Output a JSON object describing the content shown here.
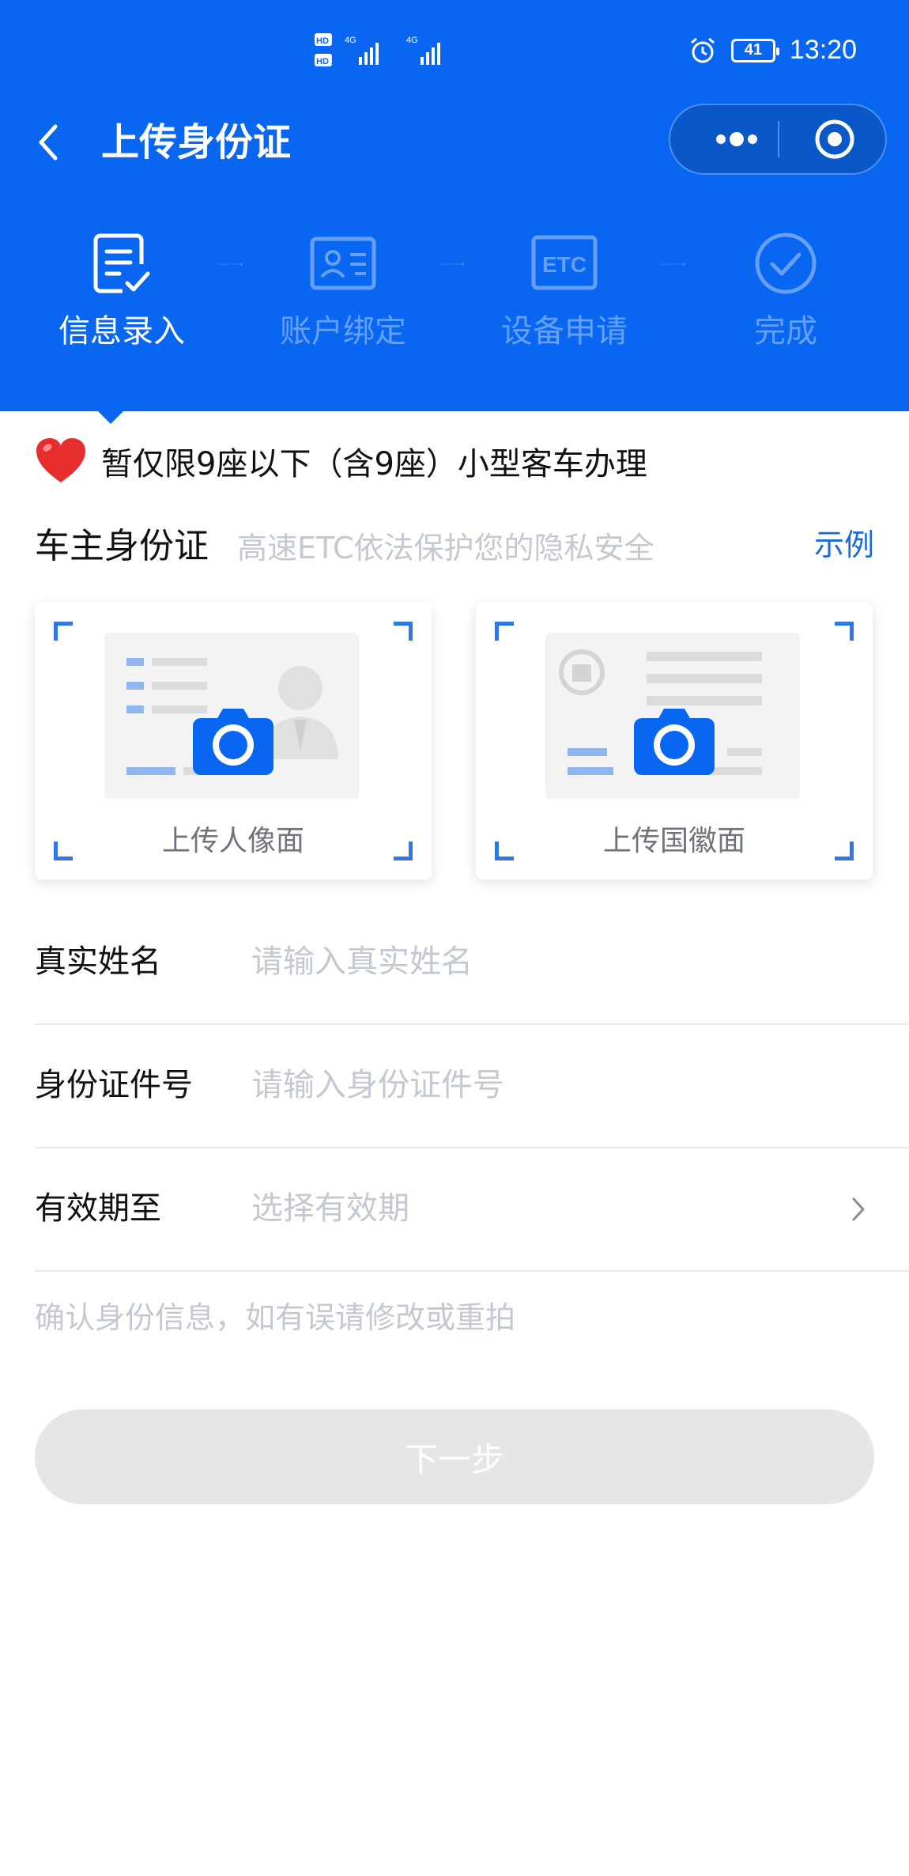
{
  "status_bar": {
    "hd1": "HD 1",
    "hd2": "HD 2",
    "net1": "4G",
    "net2": "4G",
    "battery": "41",
    "time": "13:20"
  },
  "navbar": {
    "title": "上传身份证"
  },
  "steps": [
    {
      "label": "信息录入",
      "icon": "form-edit-icon",
      "active": true
    },
    {
      "label": "账户绑定",
      "icon": "id-card-icon",
      "active": false
    },
    {
      "label": "设备申请",
      "icon": "etc-icon",
      "active": false
    },
    {
      "label": "完成",
      "icon": "check-circle-icon",
      "active": false
    }
  ],
  "step_etc_text": "ETC",
  "notice": {
    "text": "暂仅限9座以下（含9座）小型客车办理",
    "icon": "heart-icon"
  },
  "id_section": {
    "title": "车主身份证",
    "subtitle": "高速ETC依法保护您的隐私安全",
    "example": "示例"
  },
  "upload_cards": [
    {
      "label": "上传人像面",
      "icon": "camera-icon"
    },
    {
      "label": "上传国徽面",
      "icon": "camera-icon"
    }
  ],
  "form": {
    "name": {
      "label": "真实姓名",
      "placeholder": "请输入真实姓名"
    },
    "id_no": {
      "label": "身份证件号",
      "placeholder": "请输入身份证件号"
    },
    "expiry": {
      "label": "有效期至",
      "placeholder": "选择有效期"
    }
  },
  "hint": "确认身份信息，如有误请修改或重拍",
  "next_button": "下一步",
  "colors": {
    "brand": "#0866f0",
    "accent": "#1b6bd6",
    "placeholder": "#c3c8d1",
    "disabled": "#e6e6e6"
  }
}
